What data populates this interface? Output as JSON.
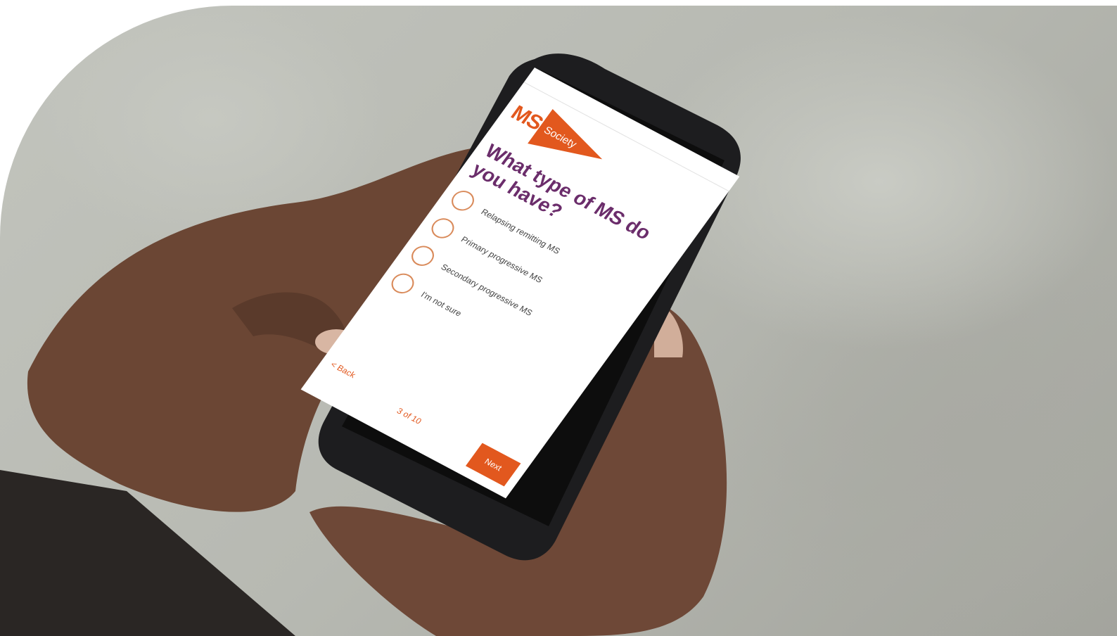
{
  "screen": {
    "status_text": "",
    "logo": {
      "ms": "MS",
      "society": "Society"
    },
    "question": "What type of MS do you have?",
    "options": [
      "Relapsing remitting MS",
      "Primary progressive MS",
      "Secondary progressive MS",
      "I'm not sure"
    ],
    "back_label": "< Back",
    "progress_label": "3 of 10",
    "next_label": "Next"
  },
  "colors": {
    "brand_orange": "#e2581e",
    "question_purple": "#6b2d6b",
    "background": "#ffffff"
  }
}
